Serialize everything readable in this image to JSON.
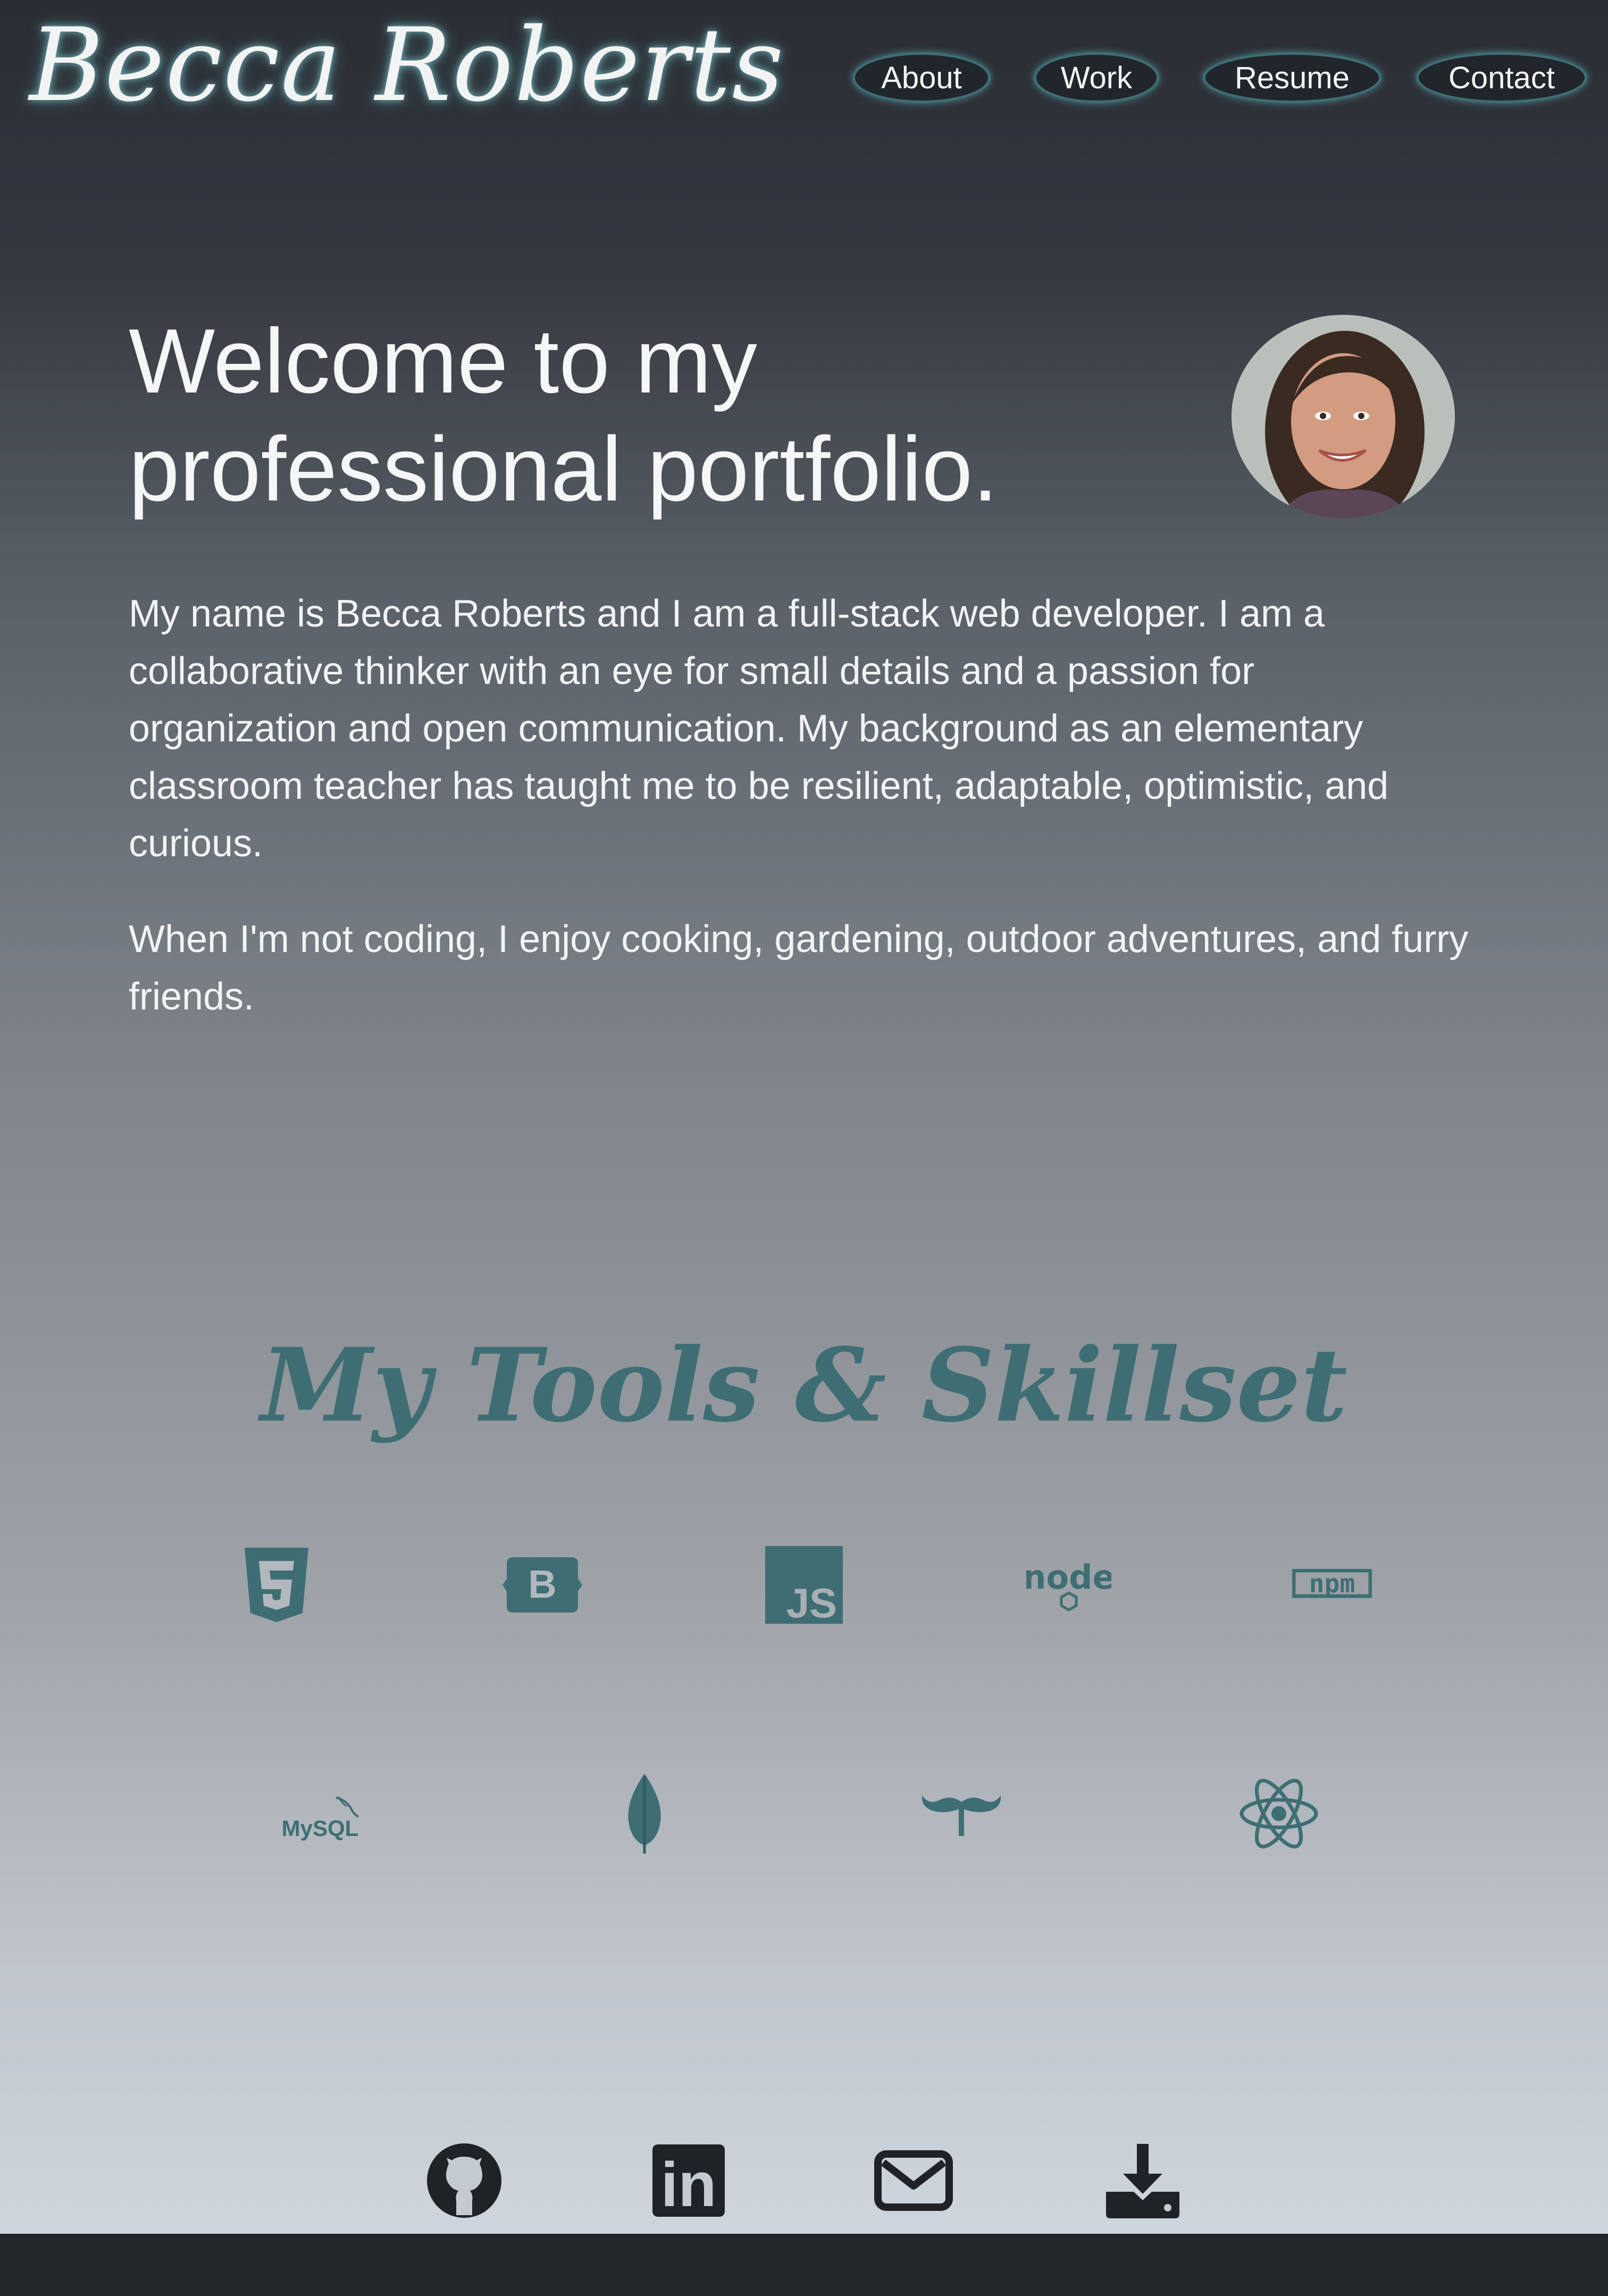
{
  "header": {
    "brand": "Becca Roberts",
    "nav": [
      "About",
      "Work",
      "Resume",
      "Contact"
    ]
  },
  "hero": {
    "title_line1": "Welcome to my",
    "title_line2": "professional portfolio."
  },
  "about": {
    "paragraphs": [
      "My name is Becca Roberts and I am a full-stack web developer. I am a collaborative thinker with an eye for small details and a passion for organization and open communication. My background as an elementary classroom teacher has taught me to be resilient, adaptable, optimistic, and curious.",
      "When I'm not coding, I enjoy cooking, gardening, outdoor adventures, and furry friends."
    ]
  },
  "skills": {
    "title": "My Tools & Skillset",
    "icons": [
      "html5-icon",
      "bootstrap-icon",
      "javascript-icon",
      "nodejs-icon",
      "npm-icon",
      "mysql-icon",
      "mongodb-icon",
      "handlebars-icon",
      "react-icon"
    ],
    "icon_text": {
      "bootstrap": "B",
      "javascript": "JS",
      "node": "node",
      "npm": "npm",
      "mysql": "MySQL"
    }
  },
  "social": {
    "icons": [
      "github-icon",
      "linkedin-icon",
      "email-icon",
      "download-icon"
    ],
    "linkedin_text": "in"
  },
  "colors": {
    "accent_teal": "#3e6e74",
    "nav_pill_bg": "#20262b",
    "footer_bg": "#23272b",
    "social_icon": "#1f2226"
  }
}
